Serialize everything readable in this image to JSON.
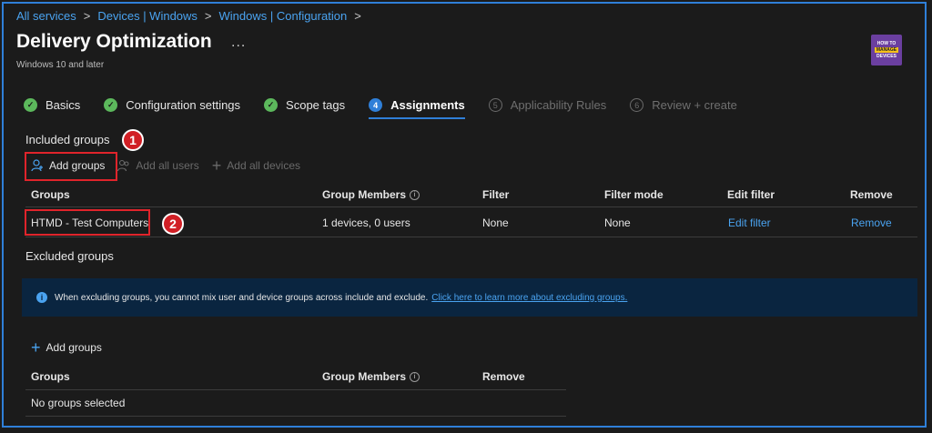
{
  "breadcrumb": [
    "All services",
    "Devices | Windows",
    "Windows | Configuration"
  ],
  "page": {
    "title": "Delivery Optimization",
    "subtitle": "Windows 10 and later",
    "more": "..."
  },
  "logo": {
    "top": "HOW TO",
    "mid": "MANAGE",
    "bottom": "DEVICES"
  },
  "steps": [
    {
      "label": "Basics",
      "icon": "check-icon",
      "state": "done",
      "num": "✓"
    },
    {
      "label": "Configuration settings",
      "icon": "check-icon",
      "state": "done",
      "num": "✓"
    },
    {
      "label": "Scope tags",
      "icon": "check-icon",
      "state": "done",
      "num": "✓"
    },
    {
      "label": "Assignments",
      "icon": "step-number-icon",
      "state": "current",
      "num": "4"
    },
    {
      "label": "Applicability Rules",
      "icon": "step-number-icon",
      "state": "pending",
      "num": "5"
    },
    {
      "label": "Review + create",
      "icon": "step-number-icon",
      "state": "pending",
      "num": "6"
    }
  ],
  "included": {
    "heading": "Included groups",
    "callout1": "1",
    "callout2": "2",
    "toolbar": {
      "add_groups": "Add groups",
      "add_all_users": "Add all users",
      "add_all_devices": "Add all devices"
    },
    "columns": [
      "Groups",
      "Group Members",
      "Filter",
      "Filter mode",
      "Edit filter",
      "Remove"
    ],
    "row": {
      "group": "HTMD - Test Computers",
      "members": "1 devices, 0 users",
      "filter": "None",
      "filter_mode": "None",
      "edit": "Edit filter",
      "remove": "Remove"
    }
  },
  "excluded": {
    "heading": "Excluded groups",
    "banner_text": "When excluding groups, you cannot mix user and device groups across include and exclude.",
    "banner_link": "Click here to learn more about excluding groups.",
    "add_groups": "Add groups",
    "columns": [
      "Groups",
      "Group Members",
      "Remove"
    ],
    "empty": "No groups selected"
  },
  "colors": {
    "accent": "#2f7fd8",
    "link": "#4aa3f0",
    "success": "#5cb85c",
    "callout": "#d11f25",
    "banner": "#0a2540"
  }
}
